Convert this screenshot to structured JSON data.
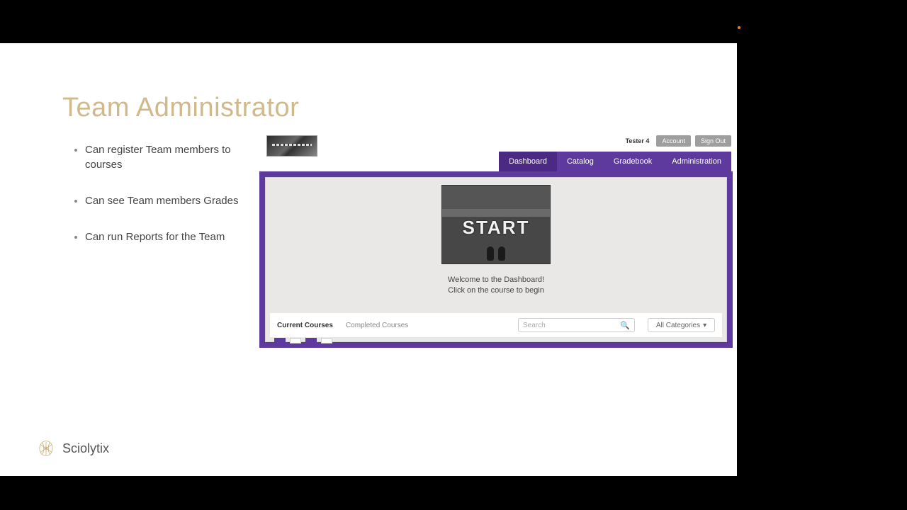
{
  "slide": {
    "title": "Team Administrator",
    "bullets": [
      "Can register Team members to courses",
      "Can see Team members Grades",
      "Can run Reports for the Team"
    ]
  },
  "app": {
    "user_name": "Tester 4",
    "account_btn": "Account",
    "signout_btn": "Sign Out",
    "nav": {
      "dashboard": "Dashboard",
      "catalog": "Catalog",
      "gradebook": "Gradebook",
      "administration": "Administration"
    },
    "hero": {
      "image_text": "START",
      "line1": "Welcome to the Dashboard!",
      "line2": "Click on the course to begin"
    },
    "course_tabs": {
      "current": "Current Courses",
      "completed": "Completed Courses"
    },
    "search_placeholder": "Search",
    "categories_label": "All Categories"
  },
  "footer": {
    "brand": "Sciolytix"
  },
  "colors": {
    "accent_purple": "#5e3a9e",
    "title_tan": "#d0b98a"
  }
}
